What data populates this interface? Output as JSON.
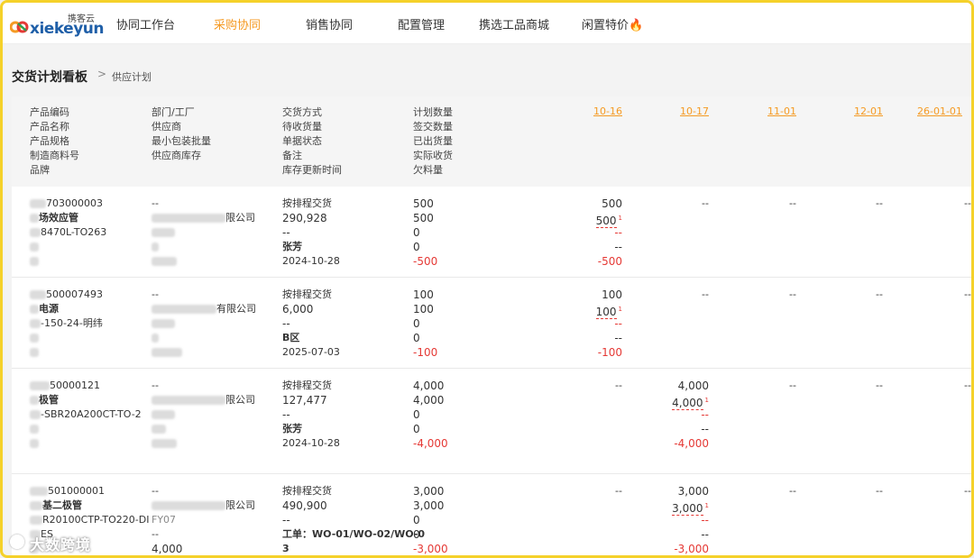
{
  "brand": {
    "small": "携客云",
    "word": "xiekeyun"
  },
  "nav": [
    {
      "label": "协同工作台"
    },
    {
      "label": "采购协同"
    },
    {
      "label": "销售协同"
    },
    {
      "label": "配置管理"
    },
    {
      "label": "携选工品商城"
    },
    {
      "label": "闲置特价"
    }
  ],
  "breadcrumb": {
    "title": "交货计划看板",
    "sep": ">",
    "sub": "供应计划"
  },
  "headers": {
    "col1": [
      "产品编码",
      "产品名称",
      "产品规格",
      "制造商料号",
      "品牌"
    ],
    "col2": [
      "部门/工厂",
      "供应商",
      "最小包装批量",
      "供应商库存"
    ],
    "col3": [
      "交货方式",
      "待收货量",
      "单据状态",
      "备注",
      "库存更新时间"
    ],
    "col4": [
      "计划数量",
      "签交数量",
      "已出货量",
      "实际收货",
      "欠料量"
    ],
    "dates": [
      "10-16",
      "10-17",
      "11-01",
      "12-01",
      "26-01-01"
    ]
  },
  "rows": [
    {
      "code": "703000003",
      "name": "场效应管",
      "spec": "8470L-TO263",
      "dept": "--",
      "supplier": "限公司",
      "mode": "按排程交货",
      "pending": "290,928",
      "status": "--",
      "note": "张芳",
      "time": "2024-10-28",
      "plan": "500",
      "sign": "500",
      "shipped": "0",
      "received": "0",
      "short": "-500",
      "d1": [
        "500",
        "500",
        "--",
        "--",
        "-500"
      ],
      "d2": "--",
      "d3": "--",
      "d4": "--",
      "d5": "--"
    },
    {
      "code": "500007493",
      "name": "电源",
      "spec": "-150-24-明纬",
      "dept": "--",
      "supplier": "有限公司",
      "mode": "按排程交货",
      "pending": "6,000",
      "status": "--",
      "note": "B区",
      "time": "2025-07-03",
      "plan": "100",
      "sign": "100",
      "shipped": "0",
      "received": "0",
      "short": "-100",
      "d1": [
        "100",
        "100",
        "--",
        "--",
        "-100"
      ],
      "d2": "--",
      "d3": "--",
      "d4": "--",
      "d5": "--"
    },
    {
      "code": "50000121",
      "name": "极管",
      "spec": "-SBR20A200CT-TO-2",
      "dept": "--",
      "supplier": "限公司",
      "mode": "按排程交货",
      "pending": "127,477",
      "status": "--",
      "note": "张芳",
      "time": "2024-10-28",
      "plan": "4,000",
      "sign": "4,000",
      "shipped": "0",
      "received": "0",
      "short": "-4,000",
      "d1": "--",
      "d2": [
        "4,000",
        "4,000",
        "--",
        "--",
        "-4,000"
      ],
      "d3": "--",
      "d4": "--",
      "d5": "--"
    },
    {
      "code": "501000001",
      "name": "基二极管",
      "spec": "R20100CTP-TO220-DI",
      "mfr": "ES",
      "dept": "--",
      "supplier": "限公司",
      "moq": "FY07",
      "stock": "4,000",
      "brand_dash": "--",
      "mode": "按排程交货",
      "pending": "490,900",
      "status": "--",
      "note": "工单：WO-01/WO-02/WO-0",
      "note2": "3",
      "plan": "3,000",
      "sign": "3,000",
      "shipped": "0",
      "received": "0",
      "short": "-3,000",
      "d1": "--",
      "d2": [
        "3,000",
        "3,000",
        "--",
        "--",
        "-3,000"
      ],
      "d3": "--",
      "d4": "--",
      "d5": "--"
    }
  ],
  "watermark": "大数跨境",
  "colors": {
    "accent": "#f59a23",
    "negative": "#e53935",
    "brand": "#1f5fa8",
    "frame": "#f5d12a"
  }
}
